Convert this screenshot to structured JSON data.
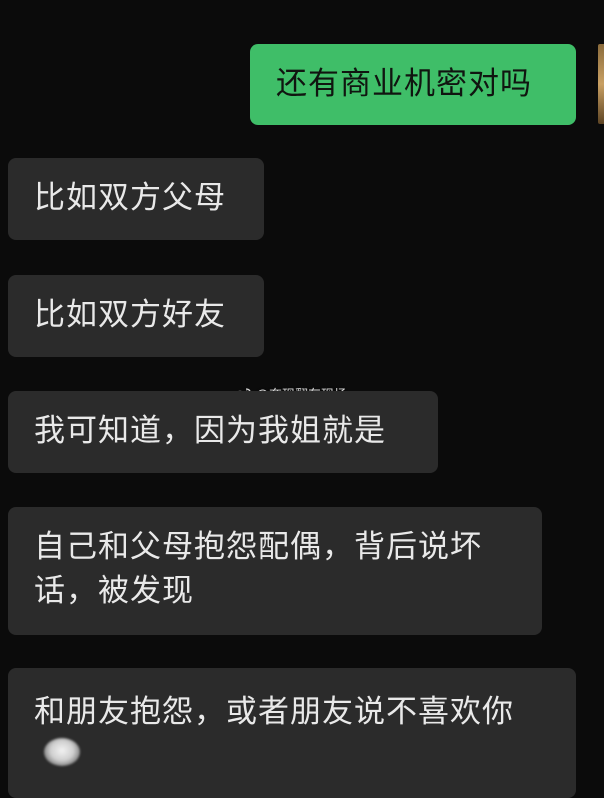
{
  "messages": [
    {
      "side": "out",
      "text": "还有商业机密对吗"
    },
    {
      "side": "in",
      "text": "比如双方父母"
    },
    {
      "side": "in",
      "text": "比如双方好友"
    },
    {
      "side": "in",
      "text": "我可知道，因为我姐就是"
    },
    {
      "side": "in",
      "text": "自己和父母抱怨配偶，背后说坏话，被发现"
    },
    {
      "side": "in",
      "text": "和朋友抱怨，或者朋友说不喜欢你"
    }
  ],
  "watermark": {
    "icon": "weibo-icon",
    "text": "@奔现翻车现场"
  },
  "colors": {
    "background": "#0b0b0b",
    "incoming_bubble": "#2b2b2b",
    "outgoing_bubble": "#3fbe68"
  }
}
